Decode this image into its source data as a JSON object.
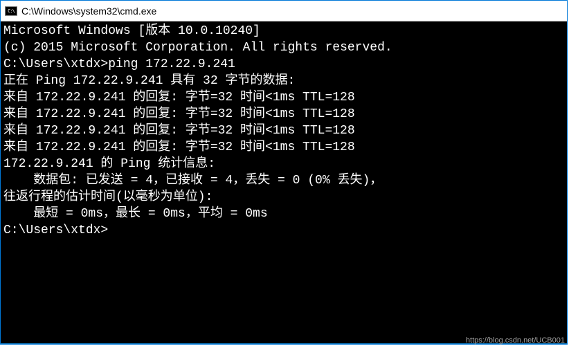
{
  "window": {
    "title": "C:\\Windows\\system32\\cmd.exe",
    "icon_label": "C:\\"
  },
  "terminal": {
    "lines": [
      "Microsoft Windows [版本 10.0.10240]",
      "(c) 2015 Microsoft Corporation. All rights reserved.",
      "",
      "C:\\Users\\xtdx>ping 172.22.9.241",
      "",
      "正在 Ping 172.22.9.241 具有 32 字节的数据:",
      "来自 172.22.9.241 的回复: 字节=32 时间<1ms TTL=128",
      "来自 172.22.9.241 的回复: 字节=32 时间<1ms TTL=128",
      "来自 172.22.9.241 的回复: 字节=32 时间<1ms TTL=128",
      "来自 172.22.9.241 的回复: 字节=32 时间<1ms TTL=128",
      "",
      "172.22.9.241 的 Ping 统计信息:",
      "    数据包: 已发送 = 4，已接收 = 4，丢失 = 0 (0% 丢失)，",
      "往返行程的估计时间(以毫秒为单位):",
      "    最短 = 0ms，最长 = 0ms，平均 = 0ms",
      "",
      "C:\\Users\\xtdx>"
    ],
    "prompt": "C:\\Users\\xtdx>",
    "command": "ping 172.22.9.241",
    "ping_target": "172.22.9.241",
    "ping_bytes": 32,
    "replies": [
      {
        "from": "172.22.9.241",
        "bytes": 32,
        "time": "<1ms",
        "ttl": 128
      },
      {
        "from": "172.22.9.241",
        "bytes": 32,
        "time": "<1ms",
        "ttl": 128
      },
      {
        "from": "172.22.9.241",
        "bytes": 32,
        "time": "<1ms",
        "ttl": 128
      },
      {
        "from": "172.22.9.241",
        "bytes": 32,
        "time": "<1ms",
        "ttl": 128
      }
    ],
    "stats": {
      "sent": 4,
      "received": 4,
      "lost": 0,
      "loss_percent": "0%",
      "min": "0ms",
      "max": "0ms",
      "avg": "0ms"
    }
  },
  "watermark": "https://blog.csdn.net/UCB001"
}
